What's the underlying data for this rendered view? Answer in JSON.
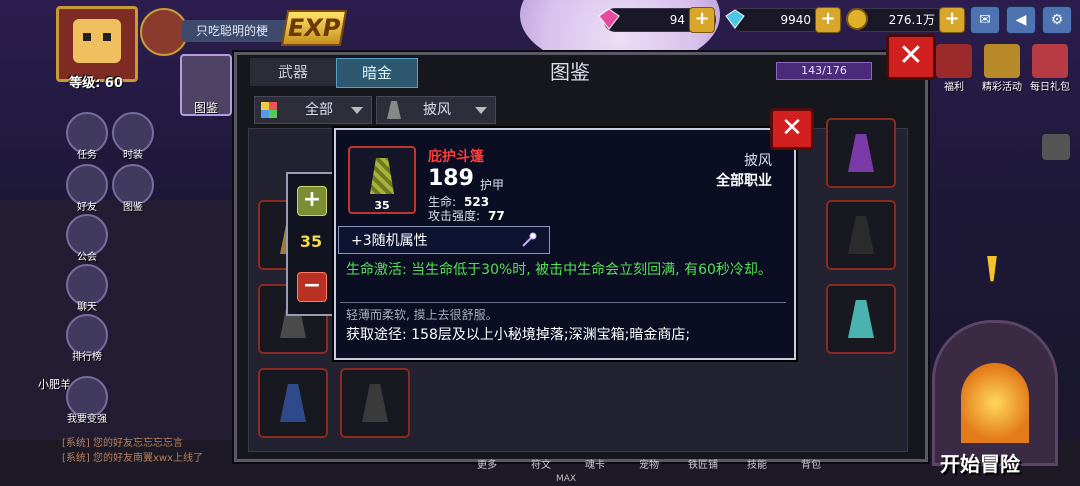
{
  "hud": {
    "level": "等级: 60",
    "player_name": "只吃聪明的梗",
    "exp_badge": "EXP",
    "gems": "94",
    "diamonds": "9940",
    "gold": "276.1万"
  },
  "left_menu": {
    "tujian": "图鉴",
    "renwu": "任务",
    "shizhuang": "时装",
    "haoyou": "好友",
    "tujian_small": "图鉴",
    "gonghui": "公会",
    "liaotian": "聊天",
    "paihang": "排行榜",
    "pet_name": "小肥羊",
    "woyao": "我要变强"
  },
  "chat": {
    "line1": "[系统] 您的好友忘忘忘忘言",
    "line2": "[系统] 您的好友南翼xwx上线了"
  },
  "right_menu": {
    "fuli": "福利",
    "jingcai": "精彩活动",
    "meiri": "每日礼包",
    "start": "开始冒险"
  },
  "panel": {
    "tab_weapon": "武器",
    "tab_dark": "暗金",
    "title": "图鉴",
    "count": "143/176",
    "filter_all": "全部",
    "filter_type": "披风",
    "close": "✕"
  },
  "popup": {
    "name": "庇护斗篷",
    "value": "189",
    "value_label": "护甲",
    "icon_level": "35",
    "stat1_label": "生命:",
    "stat1_value": "523",
    "stat2_label": "攻击强度:",
    "stat2_value": "77",
    "type": "披风",
    "class": "全部职业",
    "random_attr": "+3随机属性",
    "effect": "生命激活: 当生命低于30%时, 被击中生命会立刻回满, 有60秒冷却。",
    "flavor": "轻薄而柔软, 摸上去很舒服。",
    "source": "获取途径: 158层及以上小秘境掉落;深渊宝箱;暗金商店;",
    "close": "✕"
  },
  "stepper": {
    "plus": "+",
    "value": "35",
    "minus": "−"
  },
  "bottom_bar": [
    "更多",
    "符文",
    "魂卡",
    "宠物",
    "铁匠铺",
    "技能",
    "背包"
  ],
  "max_label": "MAX"
}
